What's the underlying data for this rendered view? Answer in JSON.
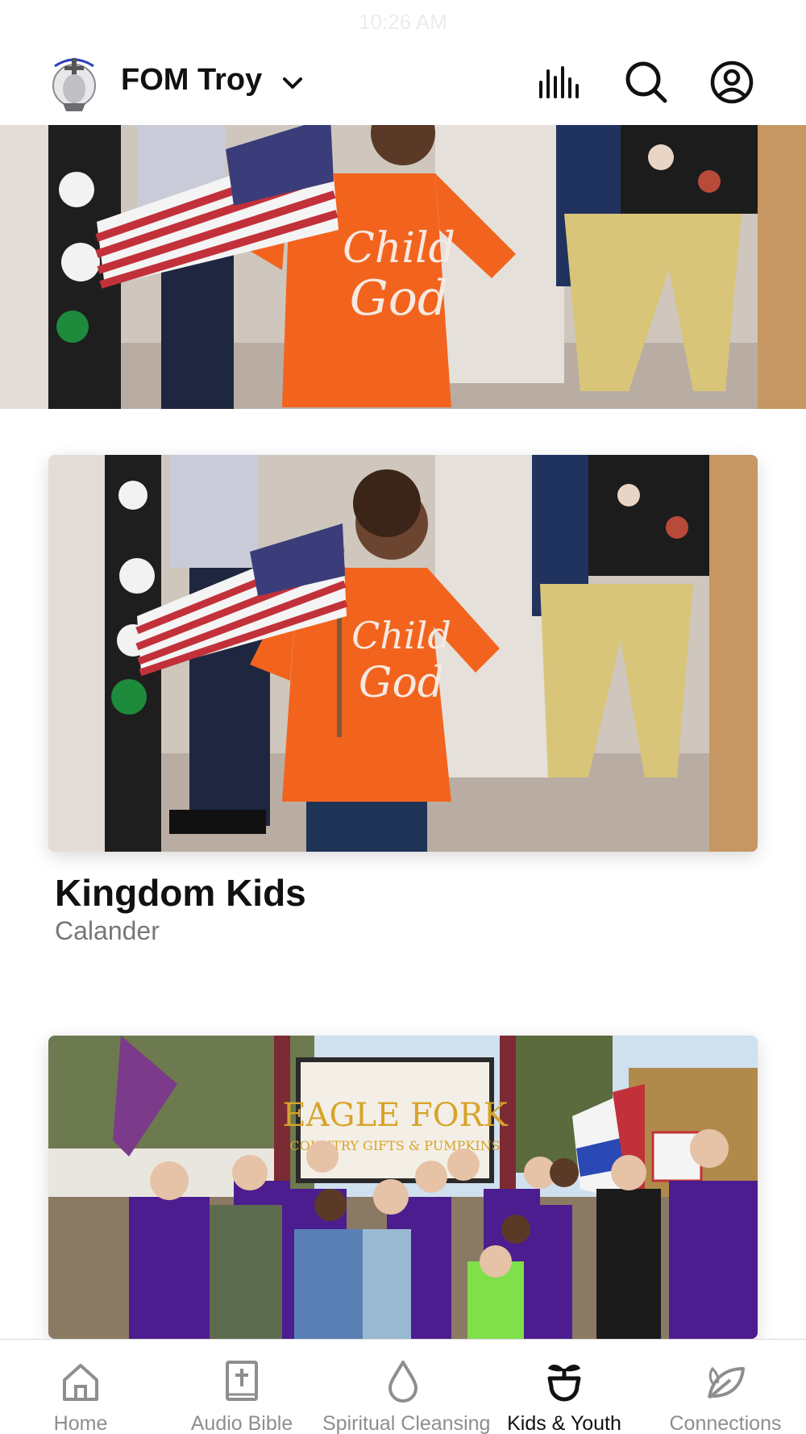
{
  "status_bar": {
    "time": "10:26 AM"
  },
  "header": {
    "org_name": "FOM Troy",
    "logo_icon": "church-globe-logo",
    "icons": [
      "chart-bars-icon",
      "search-icon",
      "account-icon"
    ]
  },
  "hero": {
    "image": "child-with-flag-photo"
  },
  "cards": [
    {
      "title": "Kingdom Kids",
      "subtitle": "Calander",
      "image": "child-with-flag-photo"
    },
    {
      "image": "youth-group-photo",
      "sign_text": "EAGLE FORK",
      "sign_subtext": "COUNTRY GIFTS & PUMPKINS"
    }
  ],
  "tabbar": {
    "items": [
      {
        "label": "Home",
        "icon": "house-icon",
        "active": false
      },
      {
        "label": "Audio Bible",
        "icon": "bible-icon",
        "active": false
      },
      {
        "label": "Spiritual Cleansing",
        "icon": "drop-icon",
        "active": false
      },
      {
        "label": "Kids & Youth",
        "icon": "sprout-icon",
        "active": true
      },
      {
        "label": "Connections",
        "icon": "leaf-icon",
        "active": false
      }
    ]
  },
  "colors": {
    "accent": "#111111",
    "inactive": "#8e8e8e",
    "shirt_orange": "#f2641e",
    "purple": "#4b1d8f"
  }
}
